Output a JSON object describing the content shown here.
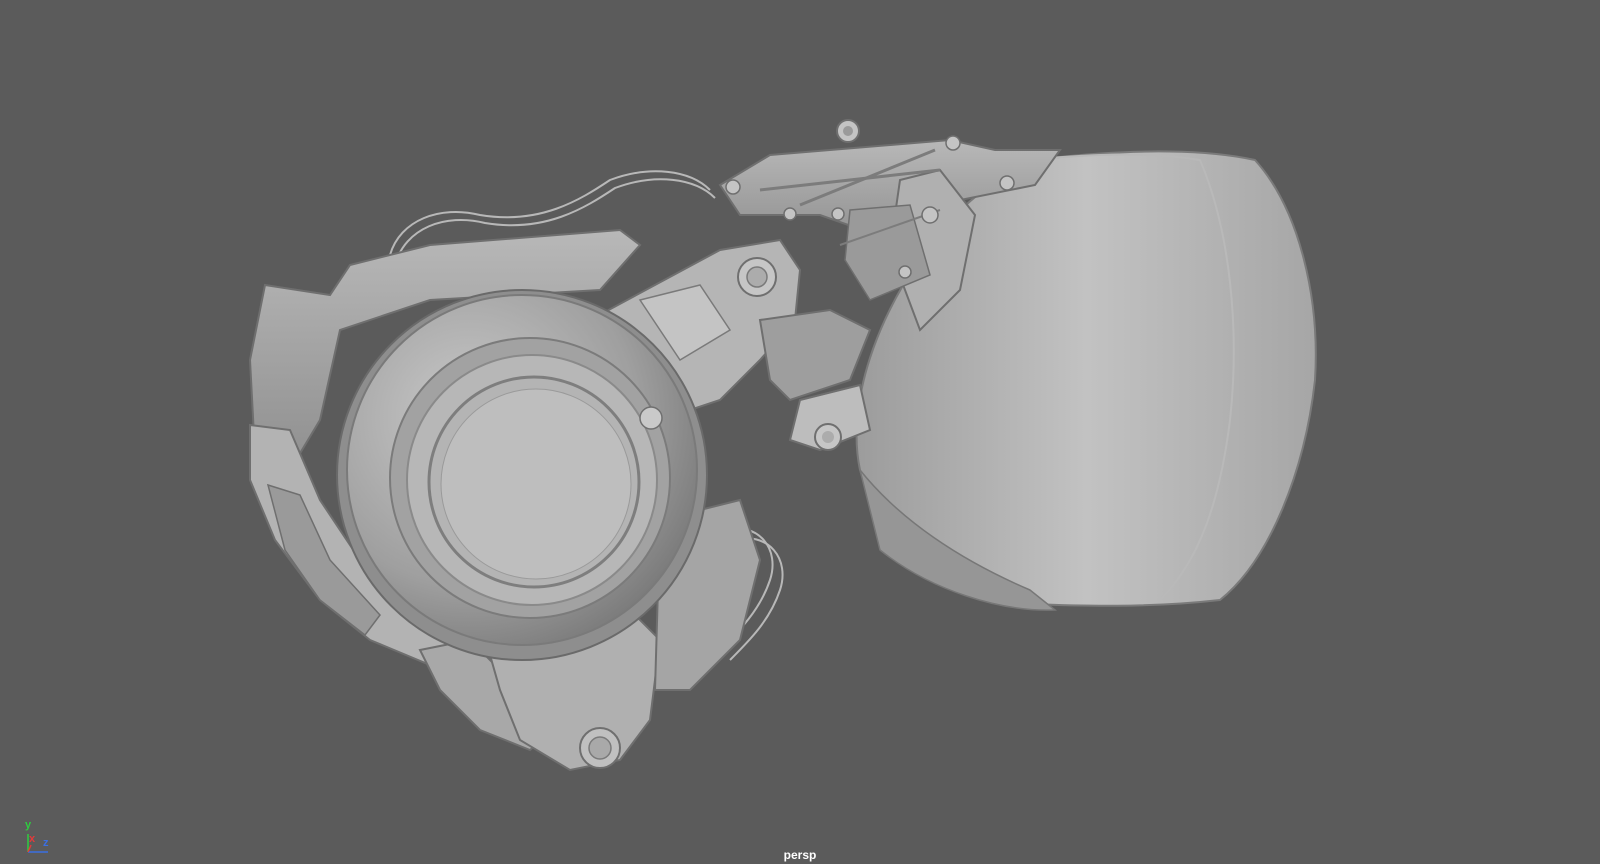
{
  "viewport": {
    "background_color": "#5b5b5b",
    "camera_name": "persp",
    "model_color": "#a9a9a9"
  },
  "axis_gizmo": {
    "y_label": "y",
    "x_label": "x",
    "z_label": "z",
    "y_color": "#2ecc40",
    "x_color": "#e23b3b",
    "z_color": "#3b6fe2"
  }
}
